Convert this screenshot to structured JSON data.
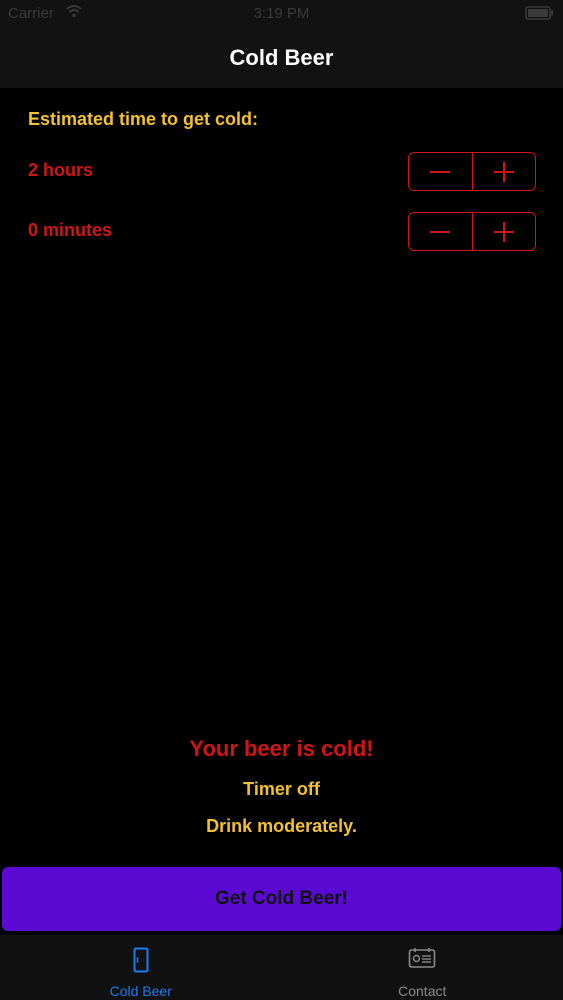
{
  "status_bar": {
    "carrier": "Carrier",
    "time": "3:19 PM"
  },
  "nav": {
    "title": "Cold Beer"
  },
  "timer": {
    "heading": "Estimated time to get cold:",
    "hours_label": "2 hours",
    "minutes_label": "0 minutes",
    "decrement_icon": "minus-icon",
    "increment_icon": "plus-icon"
  },
  "status": {
    "main": "Your beer is cold!",
    "timer_state": "Timer off",
    "note": "Drink moderately."
  },
  "action": {
    "button_label": "Get Cold Beer!"
  },
  "tabs": [
    {
      "label": "Cold Beer",
      "icon": "fridge-icon",
      "active": true
    },
    {
      "label": "Contact",
      "icon": "contact-card-icon",
      "active": false
    }
  ],
  "colors": {
    "accent_red": "#d11515",
    "accent_yellow": "#f2c12e",
    "button_purple": "#5a0ad2",
    "tab_active_blue": "#1d7bf0"
  }
}
